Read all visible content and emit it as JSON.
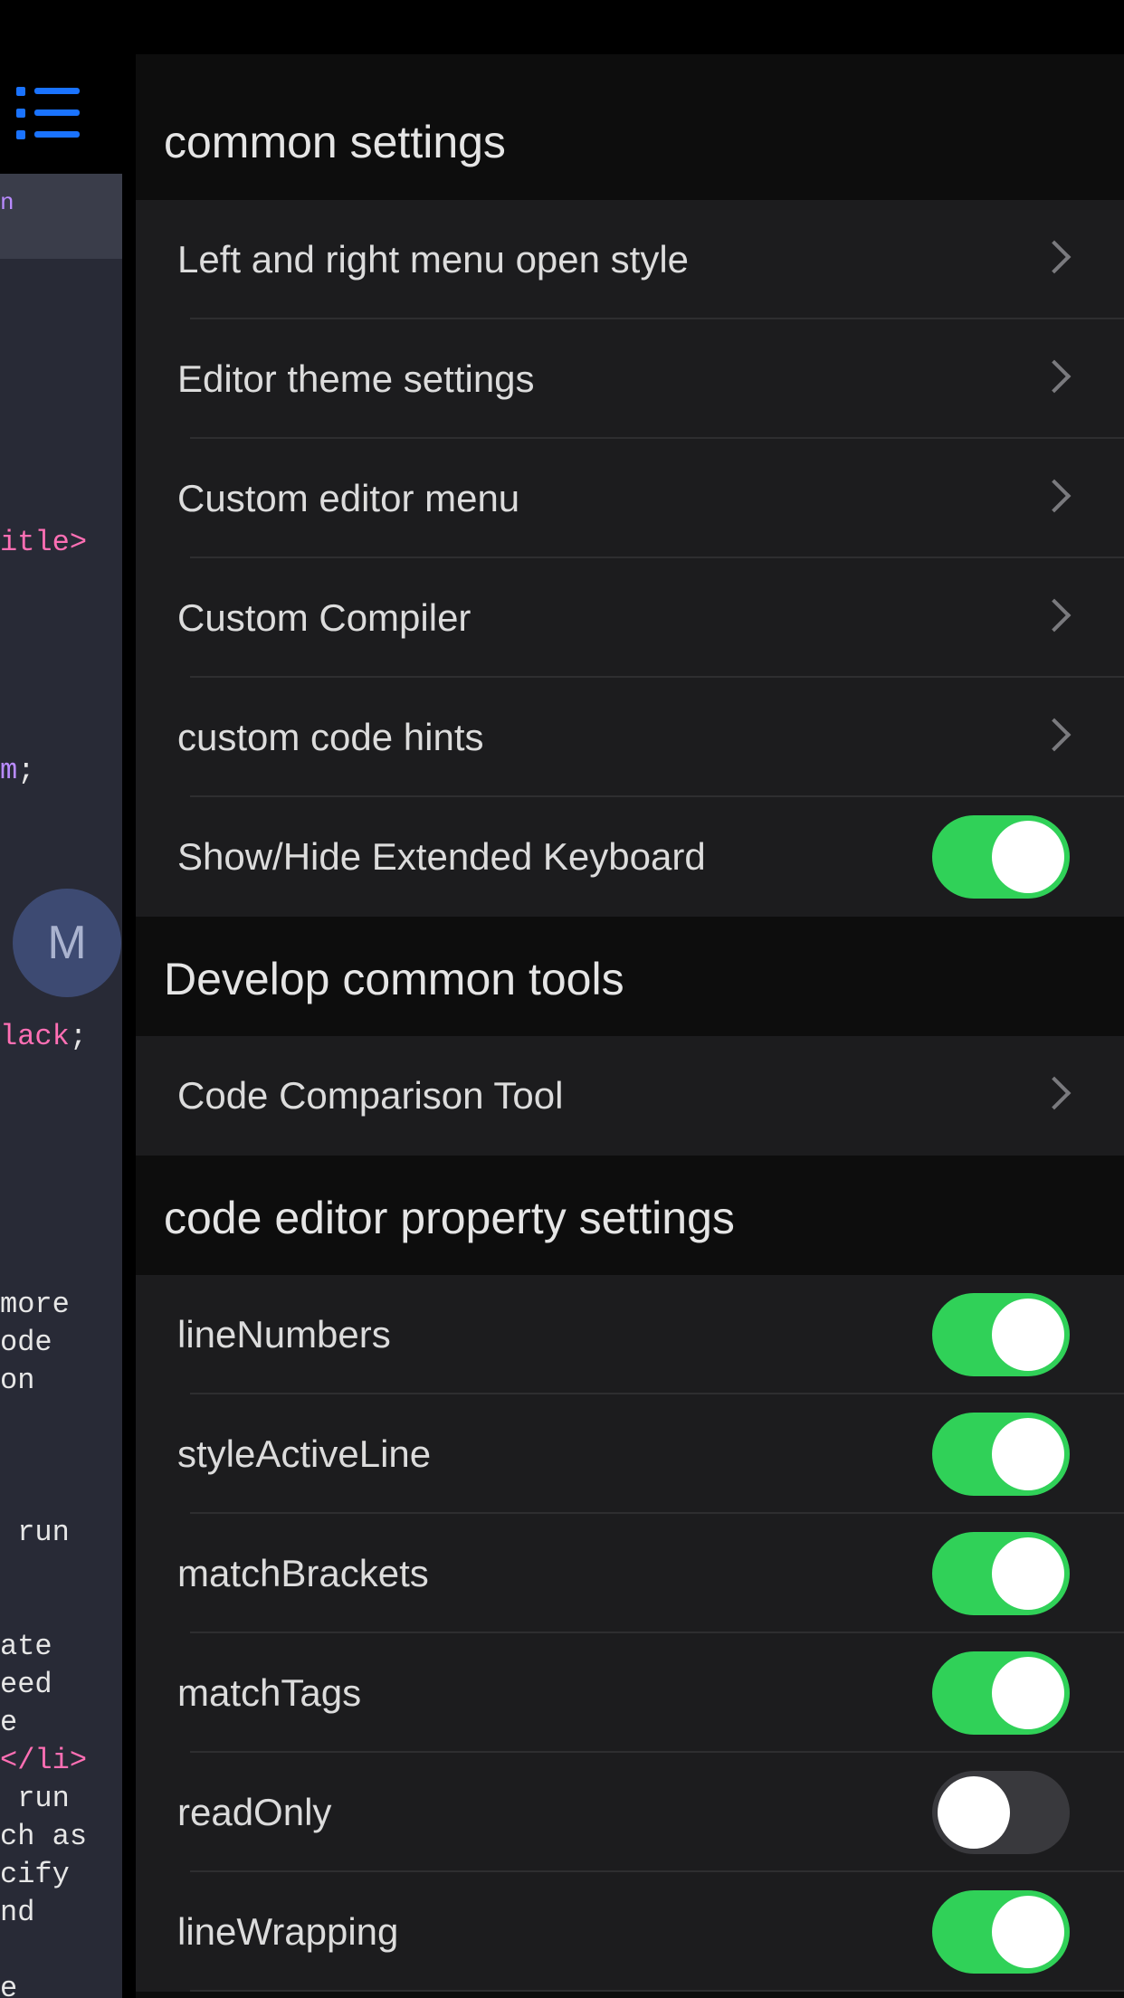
{
  "sections": [
    {
      "title": "common settings",
      "rows": [
        {
          "label": "Left and right menu open style",
          "type": "link"
        },
        {
          "label": "Editor theme settings",
          "type": "link"
        },
        {
          "label": "Custom editor menu",
          "type": "link"
        },
        {
          "label": "Custom Compiler",
          "type": "link"
        },
        {
          "label": "custom code hints",
          "type": "link"
        },
        {
          "label": "Show/Hide Extended Keyboard",
          "type": "toggle",
          "on": true
        }
      ]
    },
    {
      "title": "Develop common tools",
      "rows": [
        {
          "label": "Code Comparison Tool",
          "type": "link"
        }
      ]
    },
    {
      "title": "code editor property settings",
      "rows": [
        {
          "label": "lineNumbers",
          "type": "toggle",
          "on": true
        },
        {
          "label": "styleActiveLine",
          "type": "toggle",
          "on": true
        },
        {
          "label": "matchBrackets",
          "type": "toggle",
          "on": true
        },
        {
          "label": "matchTags",
          "type": "toggle",
          "on": true
        },
        {
          "label": "readOnly",
          "type": "toggle",
          "on": false
        },
        {
          "label": "lineWrapping",
          "type": "toggle",
          "on": true
        }
      ]
    }
  ],
  "editor": {
    "avatar_letter": "M",
    "code_fragments": [
      "n",
      "itle>",
      "m",
      ";",
      "lack",
      ";",
      "more",
      "ode",
      "on",
      " run",
      "ate",
      "eed",
      "e",
      "</li>",
      " run",
      "ch as",
      "cify",
      "nd",
      "e"
    ]
  },
  "colors": {
    "toggle_on": "#30d158",
    "toggle_off": "#39393d",
    "menu_icon": "#1a73ff",
    "row_bg": "#1c1c1e",
    "panel_bg": "#0d0d0d"
  },
  "icons": {
    "menu": "list-icon",
    "chevron": "chevron-right-icon"
  }
}
